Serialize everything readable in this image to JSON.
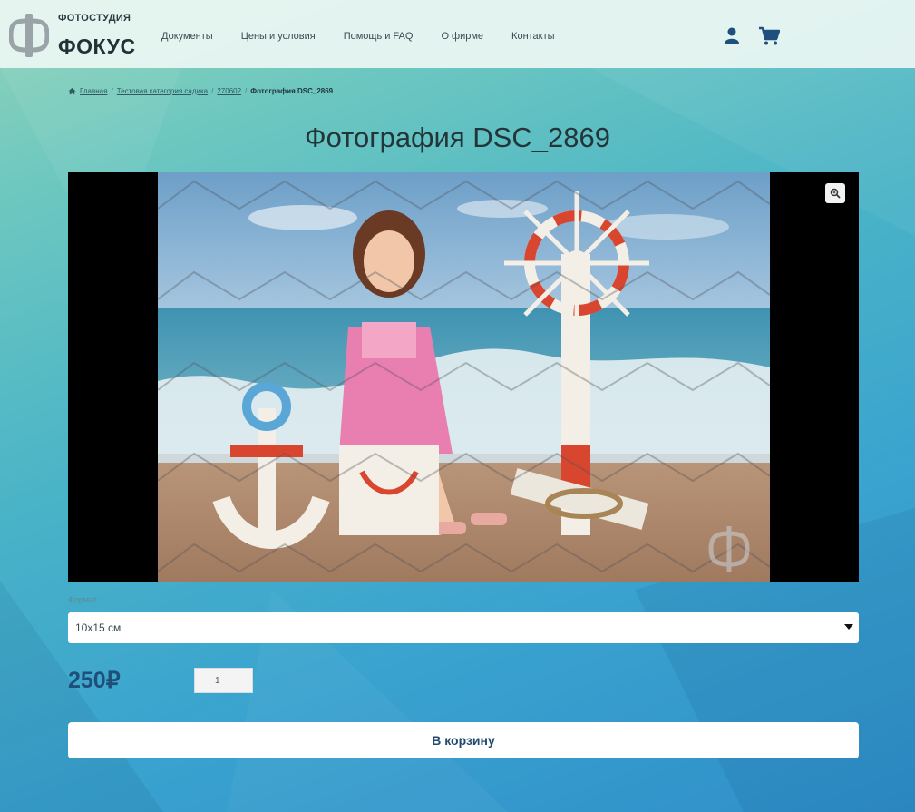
{
  "brand": {
    "small": "ФОТОСТУДИЯ",
    "big": "ФОКУС"
  },
  "nav": {
    "items": [
      {
        "label": "Документы"
      },
      {
        "label": "Цены и условия"
      },
      {
        "label": "Помощь и FAQ"
      },
      {
        "label": "О фирме"
      },
      {
        "label": "Контакты"
      }
    ]
  },
  "icons": {
    "user": "user-icon",
    "cart": "cart-icon",
    "home": "home-icon",
    "zoom": "zoom-icon",
    "caret": "caret-down-icon"
  },
  "breadcrumb": {
    "items": [
      "Главная",
      "Тестовая категория садика",
      "270602"
    ],
    "current": "Фотография DSC_2869",
    "separator": "/"
  },
  "product": {
    "title": "Фотография DSC_2869",
    "format_label": "Формат",
    "format_value": "10x15 см",
    "price": "250₽",
    "quantity": "1",
    "add_to_cart": "В корзину"
  },
  "colors": {
    "header_bg": "#ecf6f3",
    "price": "#1e4f79",
    "button_text": "#234a6e"
  }
}
